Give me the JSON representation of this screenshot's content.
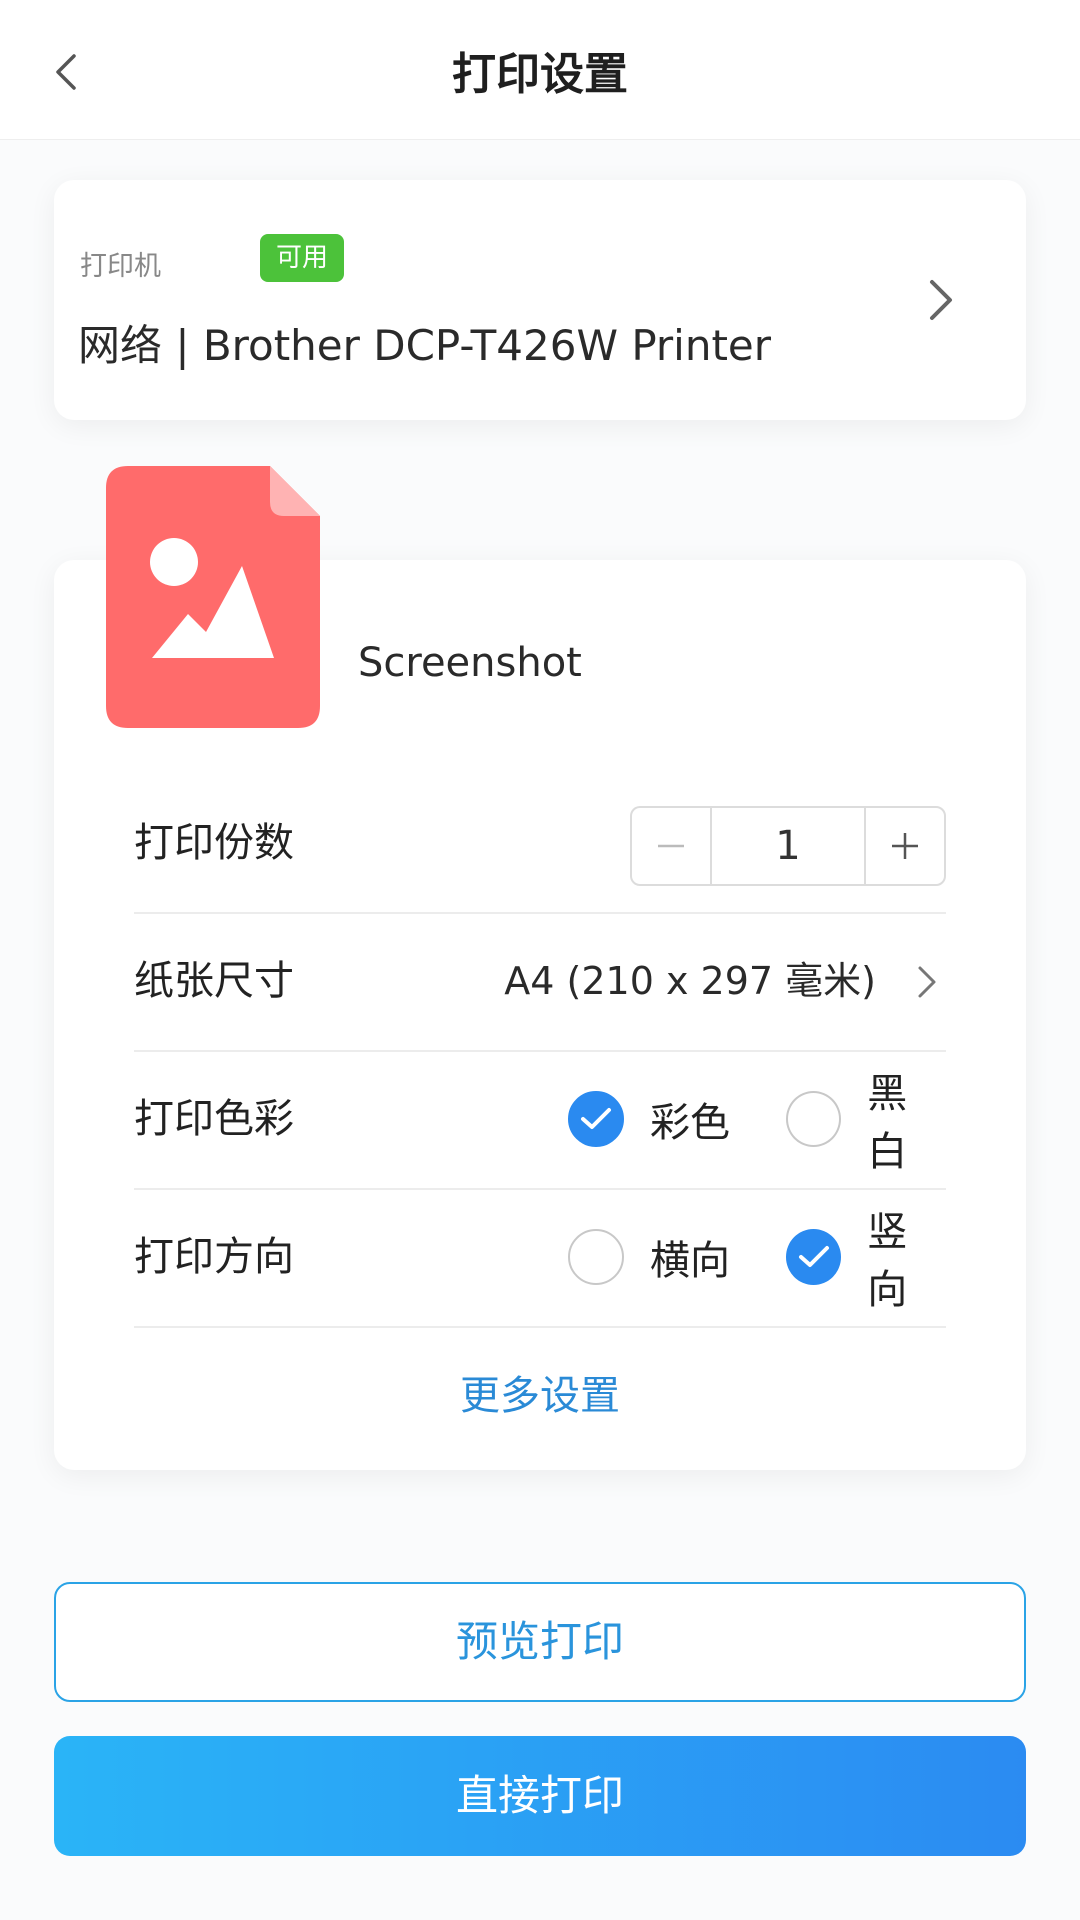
{
  "header": {
    "title": "打印设置",
    "back_icon": "chevron-left-icon"
  },
  "printer": {
    "label": "打印机",
    "status": "可用",
    "status_color": "#4cc23a",
    "name": "网络 | Brother DCP-T426W Printer"
  },
  "file": {
    "icon": "image-file-icon",
    "icon_color": "#ff6b6b",
    "name": "Screenshot"
  },
  "settings": {
    "copies": {
      "label": "打印份数",
      "value": "1"
    },
    "paper": {
      "label": "纸张尺寸",
      "value": "A4 (210 x 297 毫米)"
    },
    "color": {
      "label": "打印色彩",
      "options": [
        {
          "label": "彩色",
          "checked": true
        },
        {
          "label": "黑白",
          "checked": false
        }
      ]
    },
    "orientation": {
      "label": "打印方向",
      "options": [
        {
          "label": "横向",
          "checked": false
        },
        {
          "label": "竖向",
          "checked": true
        }
      ]
    },
    "more_label": "更多设置"
  },
  "actions": {
    "preview_label": "预览打印",
    "print_label": "直接打印"
  },
  "colors": {
    "accent": "#2a8af0",
    "link": "#2a8ad6",
    "button_gradient_start": "#2ab4f7",
    "button_gradient_end": "#2b8bf2"
  }
}
